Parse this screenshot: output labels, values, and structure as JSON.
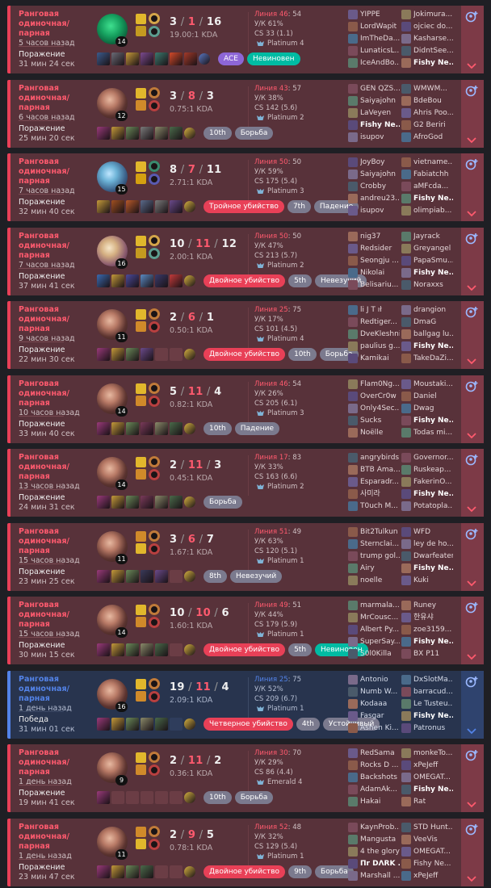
{
  "colors": {
    "loss_accent": "#e84057",
    "win_accent": "#5383e8",
    "loss_bg": "#58323a",
    "win_bg": "#28344e"
  },
  "icons": {
    "expand": "chevron-down-icon",
    "add": "add-friend-icon"
  },
  "matches": [
    {
      "result": "loss",
      "queue": "Ранговая одиночная/парная",
      "ago": "5 часов назад",
      "result_label": "Поражение",
      "duration": "31 мин 24 сек",
      "level": "14",
      "kills": "3",
      "deaths": "1",
      "assists": "16",
      "kda_ratio": "19.00:1 KDA",
      "lane": "Линия 46",
      "lane_extra": ": 54",
      "kp": "У/К 61%",
      "cs": "CS 33 (1.1)",
      "rank": "Platinum 4",
      "champ_style": "c1",
      "spells": [
        "#e1b72c",
        "#c49a20"
      ],
      "runes": [
        "#d4a54a",
        "#5c9c8f"
      ],
      "items": [
        "#3b5b8c",
        "#6b6b76",
        "#c69a3a",
        "#7b4a8e",
        "#3b7a6e",
        "#d44a2a",
        "#a33a2a",
        "#5a78c2"
      ],
      "badges": [
        {
          "text": "ACE",
          "type": "ace"
        },
        {
          "text": "Невиновен",
          "type": "green"
        }
      ],
      "team1": [
        "YIPPE",
        "LordWapit",
        "ImTheDa...",
        "LunaticsL...",
        "IceAndBo..."
      ],
      "team2": [
        "Jokimura...",
        "ojciec do...",
        "Kasharse...",
        "DidntSee...",
        "Fishy Ne..."
      ],
      "me": [
        1,
        4
      ]
    },
    {
      "result": "loss",
      "queue": "Ранговая одиночная/парная",
      "ago": "6 часов назад",
      "result_label": "Поражение",
      "duration": "25 мин 20 сек",
      "level": "12",
      "kills": "3",
      "deaths": "8",
      "assists": "3",
      "kda_ratio": "0.75:1 KDA",
      "lane": "Линия 43",
      "lane_extra": ": 57",
      "kp": "У/К 38%",
      "cs": "CS 142 (5.6)",
      "rank": "Platinum 2",
      "champ_style": "c2",
      "spells": [
        "#e1b72c",
        "#d08a2a"
      ],
      "runes": [
        "#c07a3a",
        "#b84040"
      ],
      "items": [
        "#9a3a7a",
        "#c49a3a",
        "#6b8a5a",
        "#7a7a7a",
        "#8a8a6a",
        "#4a6a4a",
        "#d4b040"
      ],
      "badges": [
        {
          "text": "10th",
          "type": "grey"
        },
        {
          "text": "Борьба",
          "type": "grey"
        }
      ],
      "team1": [
        "GEN QZS...",
        "Saiyajohn",
        "LaVeyen",
        "Fishy Ne...",
        "isupov"
      ],
      "team2": [
        "WMWM...",
        "BdeBou",
        "Ahris Poo...",
        "G2 Beriri",
        "AfroGod"
      ],
      "me": [
        0,
        3
      ]
    },
    {
      "result": "loss",
      "queue": "Ранговая одиночная/парная",
      "ago": "7 часов назад",
      "result_label": "Поражение",
      "duration": "32 мин 40 сек",
      "level": "15",
      "kills": "8",
      "deaths": "7",
      "assists": "11",
      "kda_ratio": "2.71:1 KDA",
      "lane": "Линия 50",
      "lane_extra": ": 50",
      "kp": "У/К 59%",
      "cs": "CS 175 (5.4)",
      "rank": "Platinum 3",
      "champ_style": "c3",
      "spells": [
        "#e1b72c",
        "#d4a010"
      ],
      "runes": [
        "#3a8a6e",
        "#5a5ab0"
      ],
      "items": [
        "#c49a3a",
        "#a05020",
        "#b85a2a",
        "#5a6a8a",
        "#7a7a7a",
        "#6a4a8a",
        "#d4b040"
      ],
      "badges": [
        {
          "text": "Тройное убийство",
          "type": "red"
        },
        {
          "text": "7th",
          "type": "grey"
        },
        {
          "text": "Падение",
          "type": "grey"
        }
      ],
      "team1": [
        "JoyBoy",
        "Saiyajohn",
        "Crobby",
        "andreu23...",
        "isupov"
      ],
      "team2": [
        "vietname...",
        "Fabiatchh",
        "aMFcda...",
        "Fishy Ne...",
        "olimpiab..."
      ],
      "me": [
        1,
        3
      ]
    },
    {
      "result": "loss",
      "queue": "Ранговая одиночная/парная",
      "ago": "7 часов назад",
      "result_label": "Поражение",
      "duration": "37 мин 41 сек",
      "level": "16",
      "kills": "10",
      "deaths": "11",
      "assists": "12",
      "kda_ratio": "2.00:1 KDA",
      "lane": "Линия 50",
      "lane_extra": ": 50",
      "kp": "У/К 47%",
      "cs": "CS 213 (5.7)",
      "rank": "Platinum 2",
      "champ_style": "c4",
      "spells": [
        "#e1b72c",
        "#c49a20"
      ],
      "runes": [
        "#d4a54a",
        "#5c9c8f"
      ],
      "items": [
        "#3a6ab0",
        "#c49a3a",
        "#4a4a9a",
        "#5a8ac2",
        "#3a3a6a",
        "#c23a3a",
        "#d4b040"
      ],
      "badges": [
        {
          "text": "Двойное убийство",
          "type": "red"
        },
        {
          "text": "5th",
          "type": "grey"
        },
        {
          "text": "Невезучий",
          "type": "grey"
        }
      ],
      "team1": [
        "nig37",
        "Redsider",
        "Seongju ...",
        "Nikolai",
        "Belisariu..."
      ],
      "team2": [
        "Jayrack",
        "Greyangel",
        "PapaSmu...",
        "Fishy Ne...",
        "Noraxxs"
      ],
      "me": [
        1,
        3
      ]
    },
    {
      "result": "loss",
      "queue": "Ранговая одиночная/парная",
      "ago": "9 часов назад",
      "result_label": "Поражение",
      "duration": "22 мин 30 сек",
      "level": "11",
      "kills": "2",
      "deaths": "6",
      "assists": "1",
      "kda_ratio": "0.50:1 KDA",
      "lane": "Линия 25",
      "lane_extra": ": 75",
      "kp": "У/К 17%",
      "cs": "CS 101 (4.5)",
      "rank": "Platinum 4",
      "champ_style": "c2",
      "spells": [
        "#e1b72c",
        "#d08a2a"
      ],
      "runes": [
        "#c07a3a",
        "#b84040"
      ],
      "items": [
        "#9a3a7a",
        "#c49a3a",
        "#6b8a5a",
        "#6a4a8a",
        "empty",
        "empty",
        "#d4b040"
      ],
      "badges": [
        {
          "text": "Двойное убийство",
          "type": "red"
        },
        {
          "text": "10th",
          "type": "grey"
        },
        {
          "text": "Борьба",
          "type": "grey"
        }
      ],
      "team1": [
        "li J T ıł",
        "Redtiger...",
        "DveKleshni",
        "paulius g...",
        "Kamikai"
      ],
      "team2": [
        "drangion",
        "DmaG",
        "ballgag lu...",
        "Fishy Ne...",
        "TakeDaZi..."
      ],
      "me": [
        1,
        3
      ]
    },
    {
      "result": "loss",
      "queue": "Ранговая одиночная/парная",
      "ago": "10 часов назад",
      "result_label": "Поражение",
      "duration": "33 мин 40 сек",
      "level": "14",
      "kills": "5",
      "deaths": "11",
      "assists": "4",
      "kda_ratio": "0.82:1 KDA",
      "lane": "Линия 46",
      "lane_extra": ": 54",
      "kp": "У/К 26%",
      "cs": "CS 205 (6.1)",
      "rank": "Platinum 3",
      "champ_style": "c2",
      "spells": [
        "#e1b72c",
        "#d08a2a"
      ],
      "runes": [
        "#c07a3a",
        "#b84040"
      ],
      "items": [
        "#9a3a7a",
        "#c49a3a",
        "#6b8a5a",
        "#7a3a5a",
        "#8a8a6a",
        "#4a6a4a",
        "#d4b040"
      ],
      "badges": [
        {
          "text": "10th",
          "type": "grey"
        },
        {
          "text": "Падение",
          "type": "grey"
        }
      ],
      "team1": [
        "Flam0Ng...",
        "OverCr0w",
        "Only4Sec...",
        "Sucks",
        "Noëlle"
      ],
      "team2": [
        "Moustaki...",
        "Daniel",
        "Dwag",
        "Fishy Ne...",
        "Todas mi..."
      ],
      "me": [
        1,
        3
      ]
    },
    {
      "result": "loss",
      "queue": "Ранговая одиночная/парная",
      "ago": "13 часов назад",
      "result_label": "Поражение",
      "duration": "24 мин 31 сек",
      "level": "14",
      "kills": "2",
      "deaths": "11",
      "assists": "3",
      "kda_ratio": "0.45:1 KDA",
      "lane": "Линия 17",
      "lane_extra": ": 83",
      "kp": "У/К 33%",
      "cs": "CS 163 (6.6)",
      "rank": "Platinum 2",
      "champ_style": "c2",
      "spells": [
        "#e1b72c",
        "#d08a2a"
      ],
      "runes": [
        "#c07a3a",
        "#b84040"
      ],
      "items": [
        "#9a3a7a",
        "#c49a3a",
        "#6b8a5a",
        "#7a3a5a",
        "#8a8a6a",
        "#4a6a4a",
        "#d4b040"
      ],
      "badges": [
        {
          "text": "Борьба",
          "type": "grey"
        }
      ],
      "team1": [
        "angrybirds",
        "BTB Ama...",
        "Esparadr...",
        "사미라",
        "T0uch M..."
      ],
      "team2": [
        "Governor...",
        "Ruskeap...",
        "FakerinO...",
        "Fishy Ne...",
        "Potatopla..."
      ],
      "me": [
        1,
        3
      ]
    },
    {
      "result": "loss",
      "queue": "Ранговая одиночная/парная",
      "ago": "15 часов назад",
      "result_label": "Поражение",
      "duration": "23 мин 25 сек",
      "level": "11",
      "kills": "3",
      "deaths": "6",
      "assists": "7",
      "kda_ratio": "1.67:1 KDA",
      "lane": "Линия 51",
      "lane_extra": ": 49",
      "kp": "У/К 63%",
      "cs": "CS 120 (5.1)",
      "rank": "Platinum 1",
      "champ_style": "c2",
      "spells": [
        "#d08a2a",
        "#e1b72c"
      ],
      "runes": [
        "#c07a3a",
        "#b84040"
      ],
      "items": [
        "#9a3a7a",
        "#c49a3a",
        "#6b8a5a",
        "#3a3a5a",
        "#6a4a8a",
        "empty",
        "#d4b040"
      ],
      "badges": [
        {
          "text": "8th",
          "type": "grey"
        },
        {
          "text": "Невезучий",
          "type": "grey"
        }
      ],
      "team1": [
        "Bit2Tulkun",
        "Sternclai...",
        "trump gol...",
        "Airy",
        "noelle"
      ],
      "team2": [
        "WFD",
        "ley de ho...",
        "Dwarfeater",
        "Fishy Ne...",
        "Kuki"
      ],
      "me": [
        1,
        3
      ]
    },
    {
      "result": "loss",
      "queue": "Ранговая одиночная/парная",
      "ago": "15 часов назад",
      "result_label": "Поражение",
      "duration": "30 мин 15 сек",
      "level": "14",
      "kills": "10",
      "deaths": "10",
      "assists": "6",
      "kda_ratio": "1.60:1 KDA",
      "lane": "Линия 49",
      "lane_extra": ": 51",
      "kp": "У/К 44%",
      "cs": "CS 179 (5.9)",
      "rank": "Platinum 1",
      "champ_style": "c2",
      "spells": [
        "#e1b72c",
        "#d08a2a"
      ],
      "runes": [
        "#c07a3a",
        "#b84040"
      ],
      "items": [
        "#9a3a7a",
        "#c49a3a",
        "#6b8a5a",
        "#8a8a6a",
        "#4a6a4a",
        "empty",
        "#d4b040"
      ],
      "badges": [
        {
          "text": "Двойное убийство",
          "type": "red"
        },
        {
          "text": "5th",
          "type": "grey"
        },
        {
          "text": "Невиновен",
          "type": "green"
        }
      ],
      "team1": [
        "marmala...",
        "MrCousc...",
        "Albert Py...",
        "SuperSay...",
        "S0l0Killa"
      ],
      "team2": [
        "Runey",
        "한유샤",
        "zoe3159...",
        "Fishy Ne...",
        "BX P11"
      ],
      "me": [
        1,
        3
      ]
    },
    {
      "result": "win",
      "queue": "Ранговая одиночная/парная",
      "ago": "1 день назад",
      "result_label": "Победа",
      "duration": "31 мин 01 сек",
      "level": "16",
      "kills": "19",
      "deaths": "11",
      "assists": "4",
      "kda_ratio": "2.09:1 KDA",
      "lane": "Линия 25",
      "lane_extra": ": 75",
      "kp": "У/К 52%",
      "cs": "CS 209 (6.7)",
      "rank": "Platinum 1",
      "champ_style": "c2",
      "spells": [
        "#e1b72c",
        "#d08a2a"
      ],
      "runes": [
        "#c07a3a",
        "#b84040"
      ],
      "items": [
        "#9a3a7a",
        "#c49a3a",
        "#6b8a5a",
        "#8a8a6a",
        "#4a6a4a",
        "empty",
        "#d4b040"
      ],
      "badges": [
        {
          "text": "Четверное убийство",
          "type": "red"
        },
        {
          "text": "4th",
          "type": "grey"
        },
        {
          "text": "Устойчивый",
          "type": "grey"
        }
      ],
      "team1": [
        "Antonio",
        "Numb W...",
        "Kodaaa",
        "Fasgar",
        "Ashen Ki..."
      ],
      "team2": [
        "DxSlotMa...",
        "barracud...",
        "Le Tusteu...",
        "Fishy Ne...",
        "Patronus"
      ],
      "me": [
        1,
        3
      ]
    },
    {
      "result": "loss",
      "queue": "Ранговая одиночная/парная",
      "ago": "1 день назад",
      "result_label": "Поражение",
      "duration": "19 мин 41 сек",
      "level": "9",
      "kills": "2",
      "deaths": "11",
      "assists": "2",
      "kda_ratio": "0.36:1 KDA",
      "lane": "Линия 30",
      "lane_extra": ": 70",
      "kp": "У/К 29%",
      "cs": "CS 86 (4.4)",
      "rank": "Emerald 4",
      "champ_style": "c2",
      "spells": [
        "#e1b72c",
        "#d08a2a"
      ],
      "runes": [
        "#c07a3a",
        "#b84040"
      ],
      "items": [
        "#9a3a7a",
        "empty",
        "empty",
        "empty",
        "empty",
        "empty",
        "#d4b040"
      ],
      "badges": [
        {
          "text": "10th",
          "type": "grey"
        },
        {
          "text": "Борьба",
          "type": "grey"
        }
      ],
      "team1": [
        "RedSama",
        "Rocks D ...",
        "Backshots",
        "AdamAk...",
        "Hakai"
      ],
      "team2": [
        "monkeTo...",
        "xPeJeff",
        "OMEGAT...",
        "Fishy Ne...",
        "Rat"
      ],
      "me": [
        1,
        3
      ]
    },
    {
      "result": "loss",
      "queue": "Ранговая одиночная/парная",
      "ago": "1 день назад",
      "result_label": "Поражение",
      "duration": "23 мин 47 сек",
      "level": "11",
      "kills": "2",
      "deaths": "9",
      "assists": "5",
      "kda_ratio": "0.78:1 KDA",
      "lane": "Линия 52",
      "lane_extra": ": 48",
      "kp": "У/К 32%",
      "cs": "CS 129 (5.4)",
      "rank": "Platinum 1",
      "champ_style": "c2",
      "spells": [
        "#d08a2a",
        "#e1b72c"
      ],
      "runes": [
        "#c07a3a",
        "#b84040"
      ],
      "items": [
        "#9a3a7a",
        "#c49a3a",
        "#6b8a5a",
        "#4a6a4a",
        "empty",
        "empty",
        "#d4b040"
      ],
      "badges": [
        {
          "text": "Двойное убийство",
          "type": "red"
        },
        {
          "text": "9th",
          "type": "grey"
        },
        {
          "text": "Борьба",
          "type": "grey"
        }
      ],
      "team1": [
        "KaynProb...",
        "Mangusta",
        "4 the glory",
        "Πr DΛRK ...",
        "Marshall ..."
      ],
      "team2": [
        "STD Hunt...",
        "VeeVis",
        "OMEGAT...",
        "Fishy Ne...",
        "xPeJeff"
      ],
      "me": [
        0,
        3
      ]
    }
  ]
}
